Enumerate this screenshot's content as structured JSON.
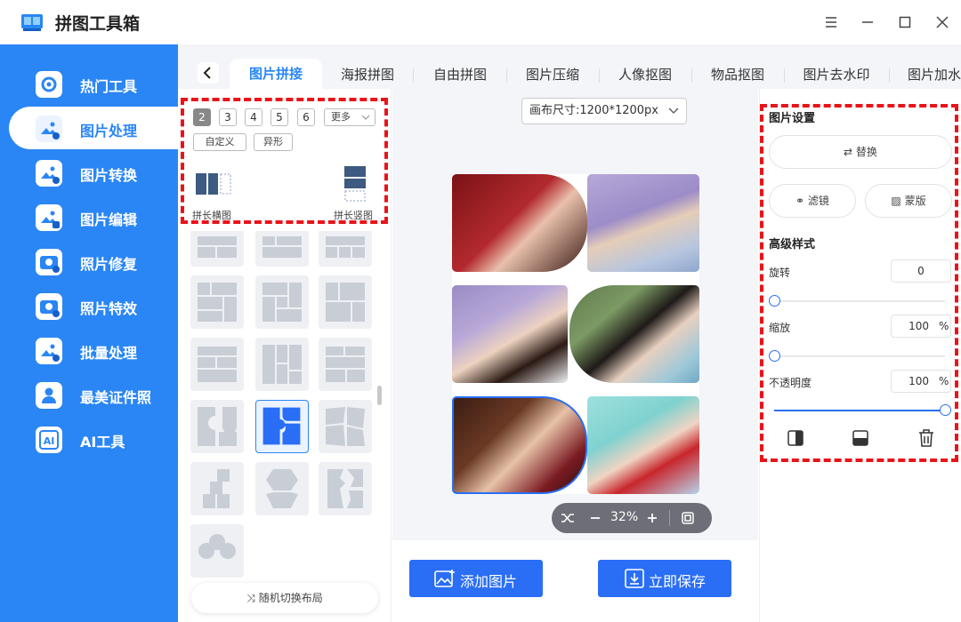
{
  "app": {
    "title": "拼图工具箱"
  },
  "window": {
    "menu_icon": "menu-icon",
    "minimize_icon": "minimize-icon",
    "maximize_icon": "maximize-icon",
    "close_icon": "close-icon"
  },
  "sidebar": {
    "items": [
      {
        "label": "热门工具",
        "icon": "tools-icon",
        "active": false
      },
      {
        "label": "图片处理",
        "icon": "image-process-icon",
        "active": true
      },
      {
        "label": "图片转换",
        "icon": "image-convert-icon",
        "active": false
      },
      {
        "label": "图片编辑",
        "icon": "image-edit-icon",
        "active": false
      },
      {
        "label": "照片修复",
        "icon": "photo-repair-icon",
        "active": false
      },
      {
        "label": "照片特效",
        "icon": "photo-effect-icon",
        "active": false
      },
      {
        "label": "批量处理",
        "icon": "batch-icon",
        "active": false
      },
      {
        "label": "最美证件照",
        "icon": "id-photo-icon",
        "active": false
      },
      {
        "label": "AI工具",
        "icon": "ai-icon",
        "active": false
      }
    ]
  },
  "tabs": {
    "back_icon": "chevron-left-icon",
    "items": [
      "图片拼接",
      "海报拼图",
      "自由拼图",
      "图片压缩",
      "人像抠图",
      "物品抠图",
      "图片去水印",
      "图片加水"
    ],
    "active": "图片拼接"
  },
  "templates": {
    "counts": [
      "2",
      "3",
      "4",
      "5",
      "6"
    ],
    "active_count": "2",
    "more_label": "更多",
    "custom_label": "自定义",
    "shaped_label": "异形",
    "horizontal_label": "拼长横图",
    "vertical_label": "拼长竖图",
    "random_layout_label": "随机切换布局"
  },
  "canvas": {
    "size_label": "画布尺寸:1200*1200px",
    "zoom": "32%"
  },
  "actions": {
    "add_image": "添加图片",
    "save_now": "立即保存"
  },
  "settings": {
    "section_title": "图片设置",
    "replace_label": "替换",
    "filter_label": "滤镜",
    "mask_label": "蒙版",
    "advanced_title": "高级样式",
    "rotate_label": "旋转",
    "rotate_value": "0",
    "rotate_level": 0,
    "scale_label": "缩放",
    "scale_value": "100",
    "scale_unit": "%",
    "scale_level": 0,
    "opacity_label": "不透明度",
    "opacity_value": "100",
    "opacity_unit": "%",
    "opacity_level": 1
  },
  "colors": {
    "accent": "#2a86f5",
    "button": "#2a6ef5",
    "highlight": "#e8141a"
  }
}
